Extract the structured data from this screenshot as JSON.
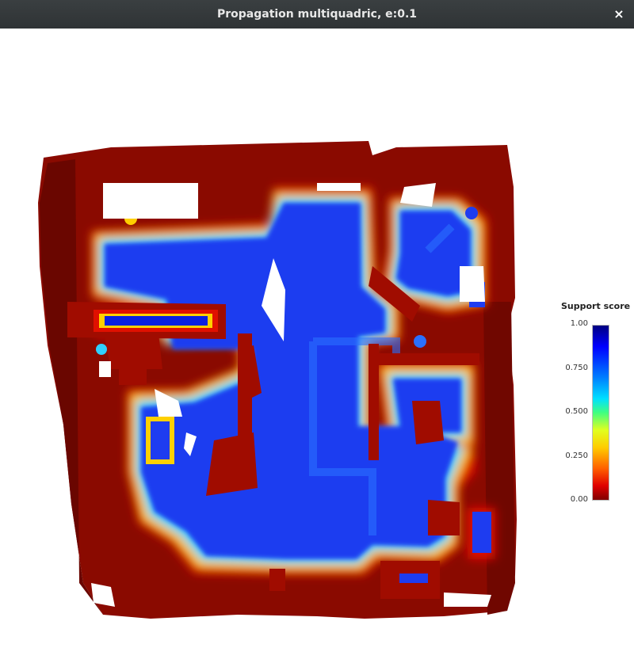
{
  "window": {
    "title": "Propagation multiquadric, e:0.1",
    "close_glyph": "×"
  },
  "legend": {
    "title": "Support score",
    "ticks": [
      "1.00",
      "0.750",
      "0.500",
      "0.250",
      "0.00"
    ],
    "colormap": [
      "#000080",
      "#0000ff",
      "#00e0ff",
      "#40ff80",
      "#ffcc00",
      "#ff6000",
      "#800000"
    ]
  },
  "colors": {
    "wall": "#8a0a00",
    "floor": "#1e3cf0",
    "edge_red": "#e01000",
    "edge_yellow": "#ffe000",
    "edge_cyan": "#40d8ff"
  }
}
